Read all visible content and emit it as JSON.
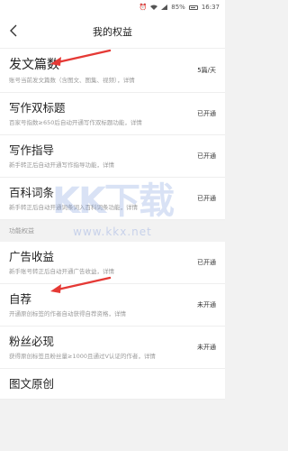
{
  "status_bar": {
    "icons": [
      "alarm-icon",
      "wifi-icon",
      "signal-icon"
    ],
    "battery": "85%",
    "time": "16:37"
  },
  "header": {
    "title": "我的权益",
    "back_icon": "chevron-left-icon"
  },
  "items": [
    {
      "name": "发文篇数",
      "desc": "账号当前发文篇数（含图文、图集、视频），详情",
      "status": "5篇/天"
    },
    {
      "name": "写作双标题",
      "desc": "百家号指数≥650后自动开通写作双标题功能，详情",
      "status": "已开通"
    },
    {
      "name": "写作指导",
      "desc": "新手转正后自动开通写作指导功能，详情",
      "status": "已开通"
    },
    {
      "name": "百科词条",
      "desc": "新手转正后自动开通词条词入百科词条功能，详情",
      "status": "已开通"
    }
  ],
  "group_label": "功能权益",
  "items2": [
    {
      "name": "广告收益",
      "desc": "新手账号转正后自动开通广告收益，详情",
      "status": "已开通"
    },
    {
      "name": "自荐",
      "desc": "开通原创标签的作者自动获得自荐资格，详情",
      "status": "未开通"
    },
    {
      "name": "粉丝必现",
      "desc": "获得原创标签且粉丝量≥1000且通过V认证的作者，详情",
      "status": "未开通"
    },
    {
      "name": "图文原创",
      "desc": "",
      "status": ""
    }
  ],
  "watermark": {
    "logo": "KK下载",
    "url": "www.kkx.net"
  },
  "colors": {
    "arrow": "#e53935",
    "status_text": "#333333",
    "desc_text": "#999999"
  }
}
